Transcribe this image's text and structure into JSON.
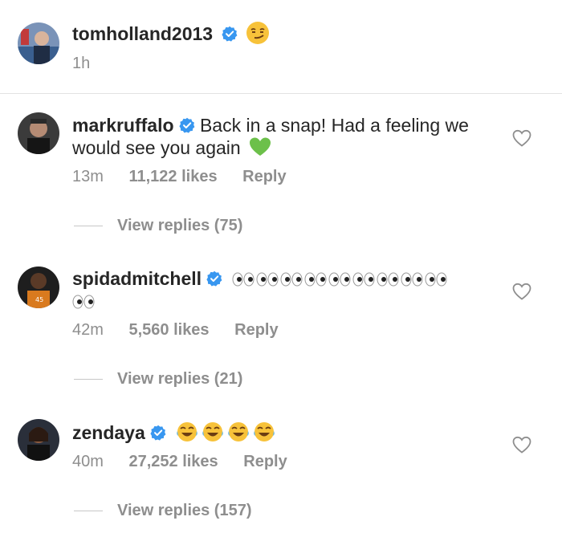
{
  "post": {
    "username": "tomholland2013",
    "time": "1h"
  },
  "comments": [
    {
      "username": "markruffalo",
      "text_line1": "Back in a snap! Had a feeling we",
      "text_line2": "would see you again",
      "time": "13m",
      "likes": "11,122 likes",
      "reply": "Reply",
      "view_replies": "View replies (75)"
    },
    {
      "username": "spidadmitchell",
      "time": "42m",
      "likes": "5,560 likes",
      "reply": "Reply",
      "view_replies": "View replies (21)"
    },
    {
      "username": "zendaya",
      "time": "40m",
      "likes": "27,252 likes",
      "reply": "Reply",
      "view_replies": "View replies (157)"
    }
  ],
  "icons": {
    "verified": "verified-badge-icon",
    "heart": "heart-outline-icon",
    "accent": "#3897f0"
  }
}
